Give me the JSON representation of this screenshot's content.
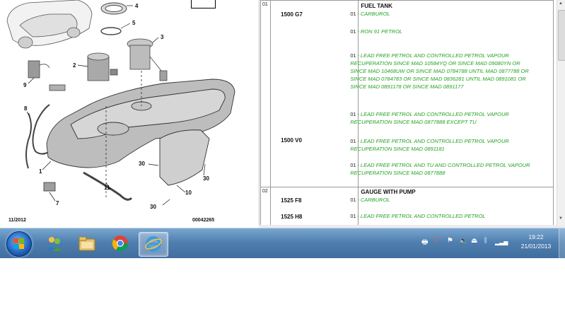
{
  "diagram": {
    "callouts": [
      "4",
      "5",
      "3",
      "2",
      "9",
      "8",
      "1",
      "7",
      "11",
      "30",
      "10",
      "30",
      "30"
    ],
    "footer_date": "11/2012",
    "footer_code": "00042265"
  },
  "parts_table": {
    "groups": [
      {
        "group": "01",
        "title": "FUEL TANK",
        "refs": [
          "1500 G7",
          "1500 V0"
        ],
        "lines": [
          {
            "code": "01",
            "text": "- CARBUROL"
          },
          {
            "code": "01",
            "text": "- RON 91 PETROL"
          },
          {
            "code": "01",
            "text": "- LEAD FREE PETROL AND CONTROLLED PETROL VAPOUR RECUPERATION SINCE MAD 10584YQ OR SINCE MAD 09080YN OR SINCE MAD 10468UW OR SINCE MAD 0784788 UNTIL MAD 0877788 OR SINCE MAD 0784783 OR SINCE MAD 0836281 UNTIL MAD 0891081 OR SINCE MAD 0891178 OR SINCE MAD 0891177"
          },
          {
            "code": "01",
            "text": "- LEAD FREE PETROL AND CONTROLLED PETROL VAPOUR RECUPERATION SINCE MAD 0877888 EXCEPT TU"
          },
          {
            "code": "01",
            "text": "- LEAD FREE PETROL AND CONTROLLED PETROL VAPOUR RECUPERATION SINCE MAD 0891181"
          },
          {
            "code": "01",
            "text": "- LEAD FREE PETROL AND TU AND CONTROLLED PETROL VAPOUR RECUPERATION SINCE MAD 0877888"
          }
        ]
      },
      {
        "group": "02",
        "title": "GAUGE WITH PUMP",
        "refs": [
          "1525 F8",
          "1525 H8"
        ],
        "lines": [
          {
            "code": "01",
            "text": "- CARBUROL"
          },
          {
            "code": "01",
            "text": "- LEAD FREE PETROL AND CONTROLLED PETROL"
          }
        ]
      }
    ]
  },
  "taskbar": {
    "pinned": [
      "start-orb",
      "users-icon",
      "explorer-folder-icon",
      "chrome-icon",
      "internet-explorer-icon"
    ],
    "active_app": "internet-explorer-icon",
    "clock_time": "19:22",
    "clock_date": "21/01/2013"
  }
}
